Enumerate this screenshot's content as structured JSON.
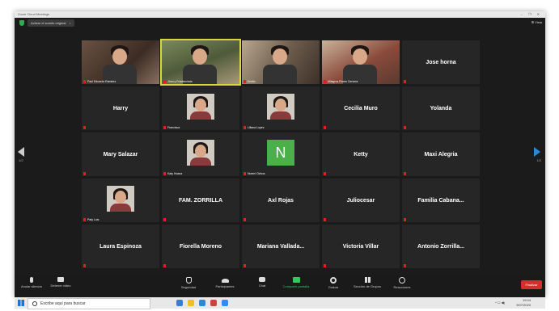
{
  "window": {
    "title": "Zoom Cloud Meetings",
    "controls": "–  ❐  ✕"
  },
  "topbar": {
    "original_sound": "Activar el sonido original",
    "view": "⊞ Vista"
  },
  "pagination": {
    "left": "1/2",
    "right": "1/2"
  },
  "participants": [
    {
      "name": "Paul Eduardo Ramirez",
      "video": true,
      "style": "v1"
    },
    {
      "name": "Jhon y Fredesvinda",
      "video": true,
      "style": "v2",
      "active": true
    },
    {
      "name": "Emilio",
      "video": true,
      "style": "v3"
    },
    {
      "name": "Milagros Flores Cervera",
      "video": true,
      "style": "v4"
    },
    {
      "name": "Jose horna"
    },
    {
      "name": "Harry"
    },
    {
      "name": "Francisca",
      "photo": true
    },
    {
      "name": "Liliana Lopez",
      "photo": true
    },
    {
      "name": "Cecilia Muro"
    },
    {
      "name": "Yolanda"
    },
    {
      "name": "Mary Salazar"
    },
    {
      "name": "Katy Huaca",
      "photo": true
    },
    {
      "name": "Noemi Ochoa",
      "initial": "N"
    },
    {
      "name": "Ketty"
    },
    {
      "name": "Maxi Alegria"
    },
    {
      "name": "Paty Luis",
      "photo": true
    },
    {
      "name": "FAM. ZORRILLA"
    },
    {
      "name": "Axl Rojas"
    },
    {
      "name": "Juliocesar"
    },
    {
      "name": "Familia Cabana..."
    },
    {
      "name": "Laura Espinoza"
    },
    {
      "name": "Fiorella Moreno"
    },
    {
      "name": "Mariana Vallada..."
    },
    {
      "name": "Victoria Villar"
    },
    {
      "name": "Antonio Zorrilla..."
    }
  ],
  "toolbar": {
    "mute": "Anular silencio",
    "start_video": "Detener video",
    "security": "Seguridad",
    "participants": "Participantes",
    "participants_count": "29",
    "chat": "Chat",
    "share": "Compartir pantalla",
    "record": "Grabar",
    "rooms": "Sección de Grupos",
    "reactions": "Reacciones",
    "end": "Finalizar"
  },
  "taskbar": {
    "search_placeholder": "Escribe aquí para buscar",
    "time": "19:04",
    "date": "9/07/2020"
  },
  "colors": {
    "accent_share": "#34c759",
    "end": "#d32f2f",
    "active_speaker": "#d7d63c"
  }
}
